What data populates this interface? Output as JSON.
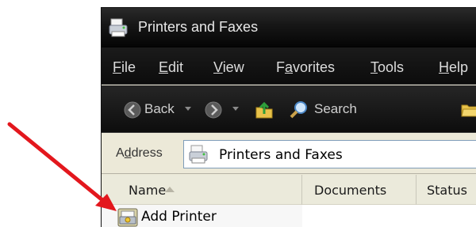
{
  "window": {
    "title": "Printers and Faxes"
  },
  "menu": {
    "items": [
      {
        "pre": "",
        "key": "F",
        "post": "ile"
      },
      {
        "pre": "",
        "key": "E",
        "post": "dit"
      },
      {
        "pre": "",
        "key": "V",
        "post": "iew"
      },
      {
        "pre": "F",
        "key": "a",
        "post": "vorites"
      },
      {
        "pre": "",
        "key": "T",
        "post": "ools"
      },
      {
        "pre": "",
        "key": "H",
        "post": "elp"
      }
    ]
  },
  "toolbar": {
    "back_label": "Back",
    "search_label": "Search"
  },
  "address": {
    "label_pre": "A",
    "label_key": "d",
    "label_post": "dress",
    "value": "Printers and Faxes"
  },
  "list": {
    "columns": [
      "Name",
      "Documents",
      "Status"
    ],
    "rows": [
      {
        "name": "Add Printer"
      }
    ]
  },
  "colors": {
    "annotation_arrow": "#e3171d",
    "title_bar": "#111111",
    "window_face": "#ece9d8"
  },
  "icons": {
    "title": "printer-fax-icon",
    "back": "back-arrow-icon",
    "forward": "forward-arrow-icon",
    "up": "up-folder-icon",
    "search": "search-magnifier-icon",
    "folders": "folders-icon",
    "address": "printer-fax-icon",
    "add_printer": "add-printer-icon"
  }
}
